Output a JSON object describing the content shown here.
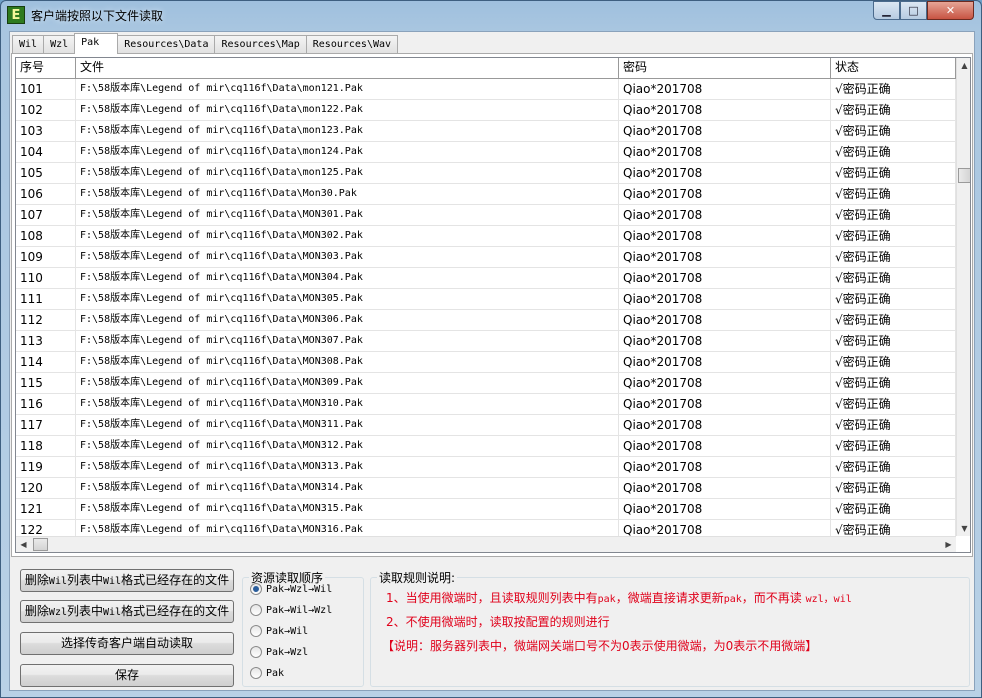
{
  "window": {
    "title": "客户端按照以下文件读取",
    "app_icon_letter": "E",
    "controls": [
      "minimize-icon",
      "maximize-icon",
      "close-icon"
    ]
  },
  "tabs": [
    {
      "label": "Wil",
      "active": false
    },
    {
      "label": "Wzl",
      "active": false
    },
    {
      "label": "Pak",
      "active": true
    },
    {
      "label": "Resources\\Data",
      "active": false
    },
    {
      "label": "Resources\\Map",
      "active": false
    },
    {
      "label": "Resources\\Wav",
      "active": false
    }
  ],
  "grid": {
    "columns": [
      "序号",
      "文件",
      "密码",
      "状态"
    ],
    "rows": [
      [
        "101",
        "F:\\58版本库\\Legend of mir\\cq116f\\Data\\mon121.Pak",
        "Qiao*201708",
        "√密码正确"
      ],
      [
        "102",
        "F:\\58版本库\\Legend of mir\\cq116f\\Data\\mon122.Pak",
        "Qiao*201708",
        "√密码正确"
      ],
      [
        "103",
        "F:\\58版本库\\Legend of mir\\cq116f\\Data\\mon123.Pak",
        "Qiao*201708",
        "√密码正确"
      ],
      [
        "104",
        "F:\\58版本库\\Legend of mir\\cq116f\\Data\\mon124.Pak",
        "Qiao*201708",
        "√密码正确"
      ],
      [
        "105",
        "F:\\58版本库\\Legend of mir\\cq116f\\Data\\mon125.Pak",
        "Qiao*201708",
        "√密码正确"
      ],
      [
        "106",
        "F:\\58版本库\\Legend of mir\\cq116f\\Data\\Mon30.Pak",
        "Qiao*201708",
        "√密码正确"
      ],
      [
        "107",
        "F:\\58版本库\\Legend of mir\\cq116f\\Data\\MON301.Pak",
        "Qiao*201708",
        "√密码正确"
      ],
      [
        "108",
        "F:\\58版本库\\Legend of mir\\cq116f\\Data\\MON302.Pak",
        "Qiao*201708",
        "√密码正确"
      ],
      [
        "109",
        "F:\\58版本库\\Legend of mir\\cq116f\\Data\\MON303.Pak",
        "Qiao*201708",
        "√密码正确"
      ],
      [
        "110",
        "F:\\58版本库\\Legend of mir\\cq116f\\Data\\MON304.Pak",
        "Qiao*201708",
        "√密码正确"
      ],
      [
        "111",
        "F:\\58版本库\\Legend of mir\\cq116f\\Data\\MON305.Pak",
        "Qiao*201708",
        "√密码正确"
      ],
      [
        "112",
        "F:\\58版本库\\Legend of mir\\cq116f\\Data\\MON306.Pak",
        "Qiao*201708",
        "√密码正确"
      ],
      [
        "113",
        "F:\\58版本库\\Legend of mir\\cq116f\\Data\\MON307.Pak",
        "Qiao*201708",
        "√密码正确"
      ],
      [
        "114",
        "F:\\58版本库\\Legend of mir\\cq116f\\Data\\MON308.Pak",
        "Qiao*201708",
        "√密码正确"
      ],
      [
        "115",
        "F:\\58版本库\\Legend of mir\\cq116f\\Data\\MON309.Pak",
        "Qiao*201708",
        "√密码正确"
      ],
      [
        "116",
        "F:\\58版本库\\Legend of mir\\cq116f\\Data\\MON310.Pak",
        "Qiao*201708",
        "√密码正确"
      ],
      [
        "117",
        "F:\\58版本库\\Legend of mir\\cq116f\\Data\\MON311.Pak",
        "Qiao*201708",
        "√密码正确"
      ],
      [
        "118",
        "F:\\58版本库\\Legend of mir\\cq116f\\Data\\MON312.Pak",
        "Qiao*201708",
        "√密码正确"
      ],
      [
        "119",
        "F:\\58版本库\\Legend of mir\\cq116f\\Data\\MON313.Pak",
        "Qiao*201708",
        "√密码正确"
      ],
      [
        "120",
        "F:\\58版本库\\Legend of mir\\cq116f\\Data\\MON314.Pak",
        "Qiao*201708",
        "√密码正确"
      ],
      [
        "121",
        "F:\\58版本库\\Legend of mir\\cq116f\\Data\\MON315.Pak",
        "Qiao*201708",
        "√密码正确"
      ],
      [
        "122",
        "F:\\58版本库\\Legend of mir\\cq116f\\Data\\MON316.Pak",
        "Qiao*201708",
        "√密码正确"
      ]
    ]
  },
  "buttons": {
    "delete_wil_prefix": "删除",
    "delete_wil_code": "Wil",
    "delete_wil_suffix": "列表中",
    "delete_wil_code2": "Wil",
    "delete_wil_tail": "格式已经存在的文件",
    "delete_wzl_prefix": "删除",
    "delete_wzl_code": "Wzl",
    "delete_wzl_suffix": "列表中",
    "delete_wzl_code2": "Wil",
    "delete_wzl_tail": "格式已经存在的文件",
    "select_client": "选择传奇客户端自动读取",
    "save": "保存"
  },
  "load_order": {
    "legend": "资源读取顺序",
    "options": [
      {
        "label": "Pak→Wzl→Wil",
        "selected": true
      },
      {
        "label": "Pak→Wil→Wzl",
        "selected": false
      },
      {
        "label": "Pak→Wil",
        "selected": false
      },
      {
        "label": "Pak→Wzl",
        "selected": false
      },
      {
        "label": "Pak",
        "selected": false
      }
    ]
  },
  "rules": {
    "legend": "读取规则说明:",
    "line1_a": "1、当使用微端时，且读取规则列表中有",
    "line1_b": "pak",
    "line1_c": "，微端直接请求更新",
    "line1_d": "pak",
    "line1_e": "，而不再读 ",
    "line1_f": "wzl，wil",
    "line2": "2、不使用微端时，读取按配置的规则进行",
    "line3": "【说明：服务器列表中，微端网关端口号不为0表示使用微端，为0表示不用微端】",
    "color": "#e0001a"
  }
}
